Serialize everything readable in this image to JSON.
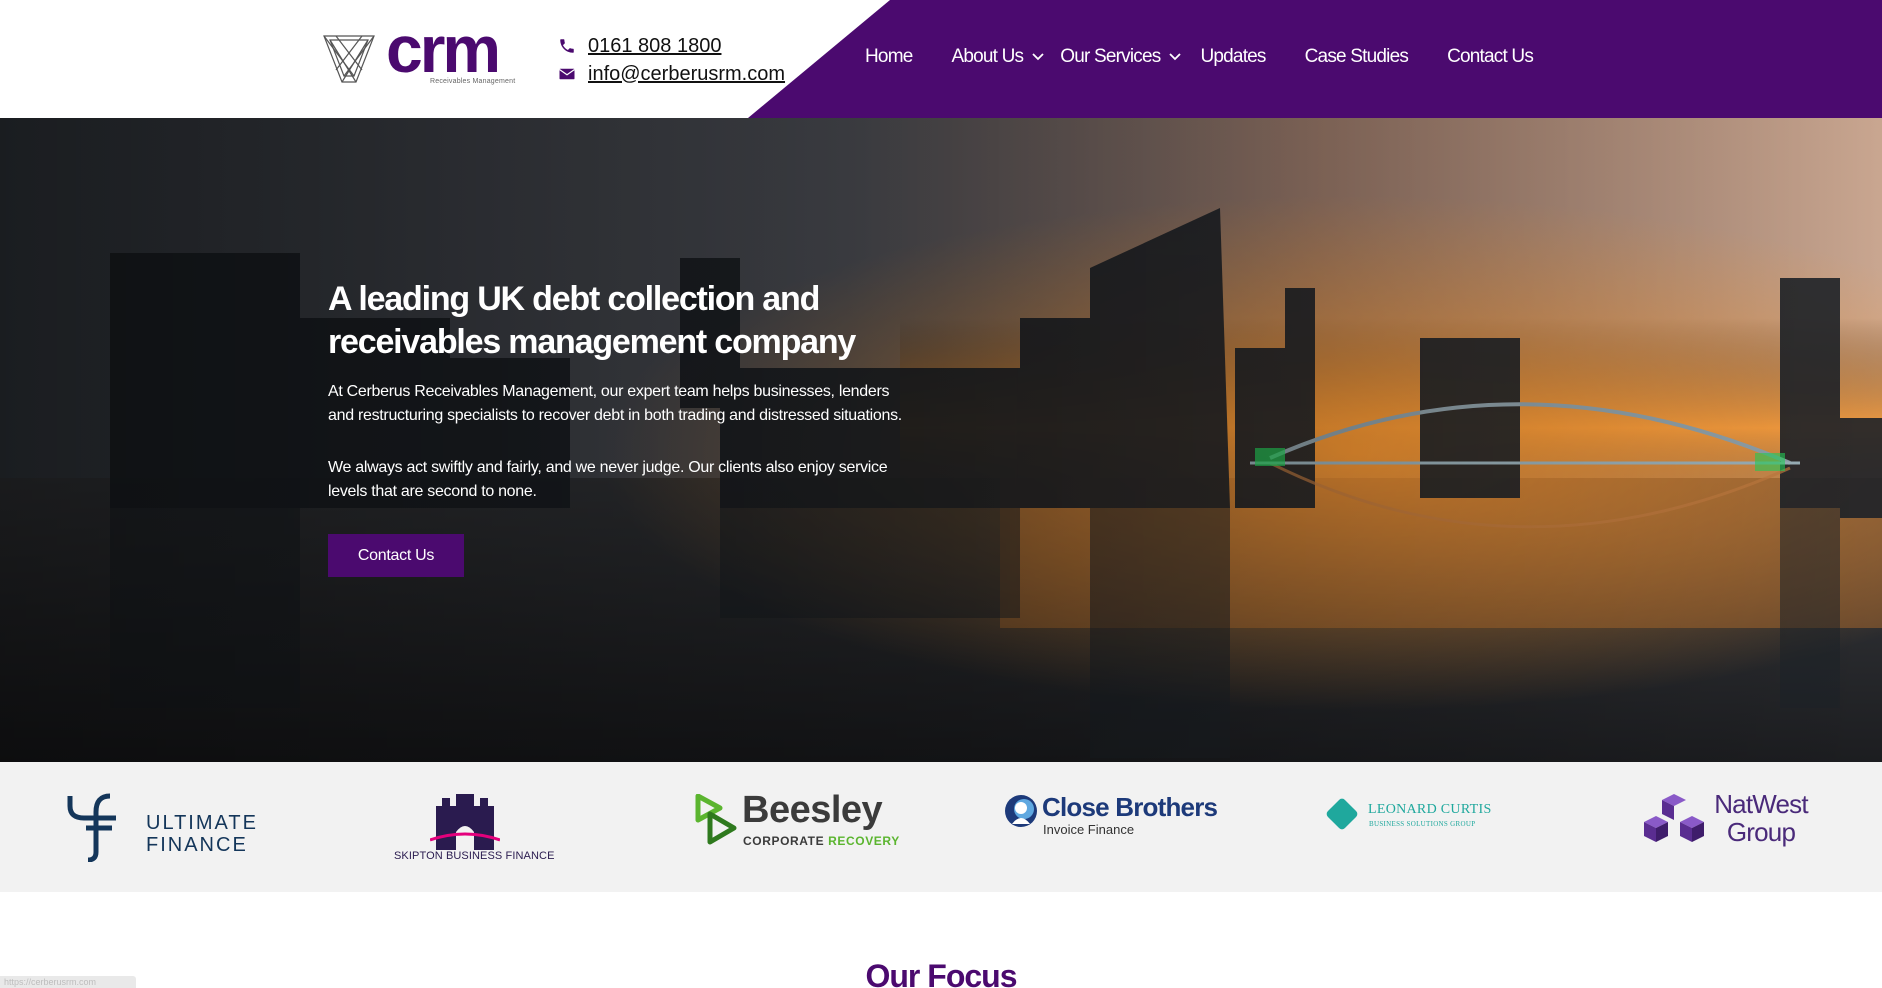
{
  "brand": {
    "logo_text": "crm",
    "logo_subtitle": "Receivables Management",
    "primary_color": "#4b0a6f"
  },
  "contact": {
    "phone": "0161 808 1800",
    "email": "info@cerberusrm.com",
    "phone_icon": "phone-icon",
    "email_icon": "envelope-icon"
  },
  "nav": {
    "home": "Home",
    "about": "About Us",
    "services": "Our Services",
    "updates": "Updates",
    "case_studies": "Case Studies",
    "contact": "Contact Us"
  },
  "hero": {
    "title": "A leading UK debt collection and receivables management company",
    "paragraph_1": "At Cerberus Receivables Management, our expert team helps businesses, lenders and restructuring specialists to recover debt in both trading and distressed situations.",
    "paragraph_2": "We always act swiftly and fairly, and we never judge. Our clients also enjoy service levels that are second to none.",
    "button": "Contact Us"
  },
  "partners": {
    "ultimate_line1": "ULTIMATE",
    "ultimate_line2": "FINANCE",
    "skipton": "SKIPTON BUSINESS FINANCE",
    "beesley_name": "Beesley",
    "beesley_corporate": "CORPORATE",
    "beesley_recovery": "RECOVERY",
    "close_name": "Close Brothers",
    "close_sub": "Invoice Finance",
    "leonard_name": "LEONARD CURTIS",
    "leonard_sub": "BUSINESS SOLUTIONS GROUP",
    "natwest_line1": "NatWest",
    "natwest_line2": "Group"
  },
  "focus": {
    "title": "Our Focus"
  },
  "status_bar": {
    "url": "https://cerberusrm.com"
  }
}
